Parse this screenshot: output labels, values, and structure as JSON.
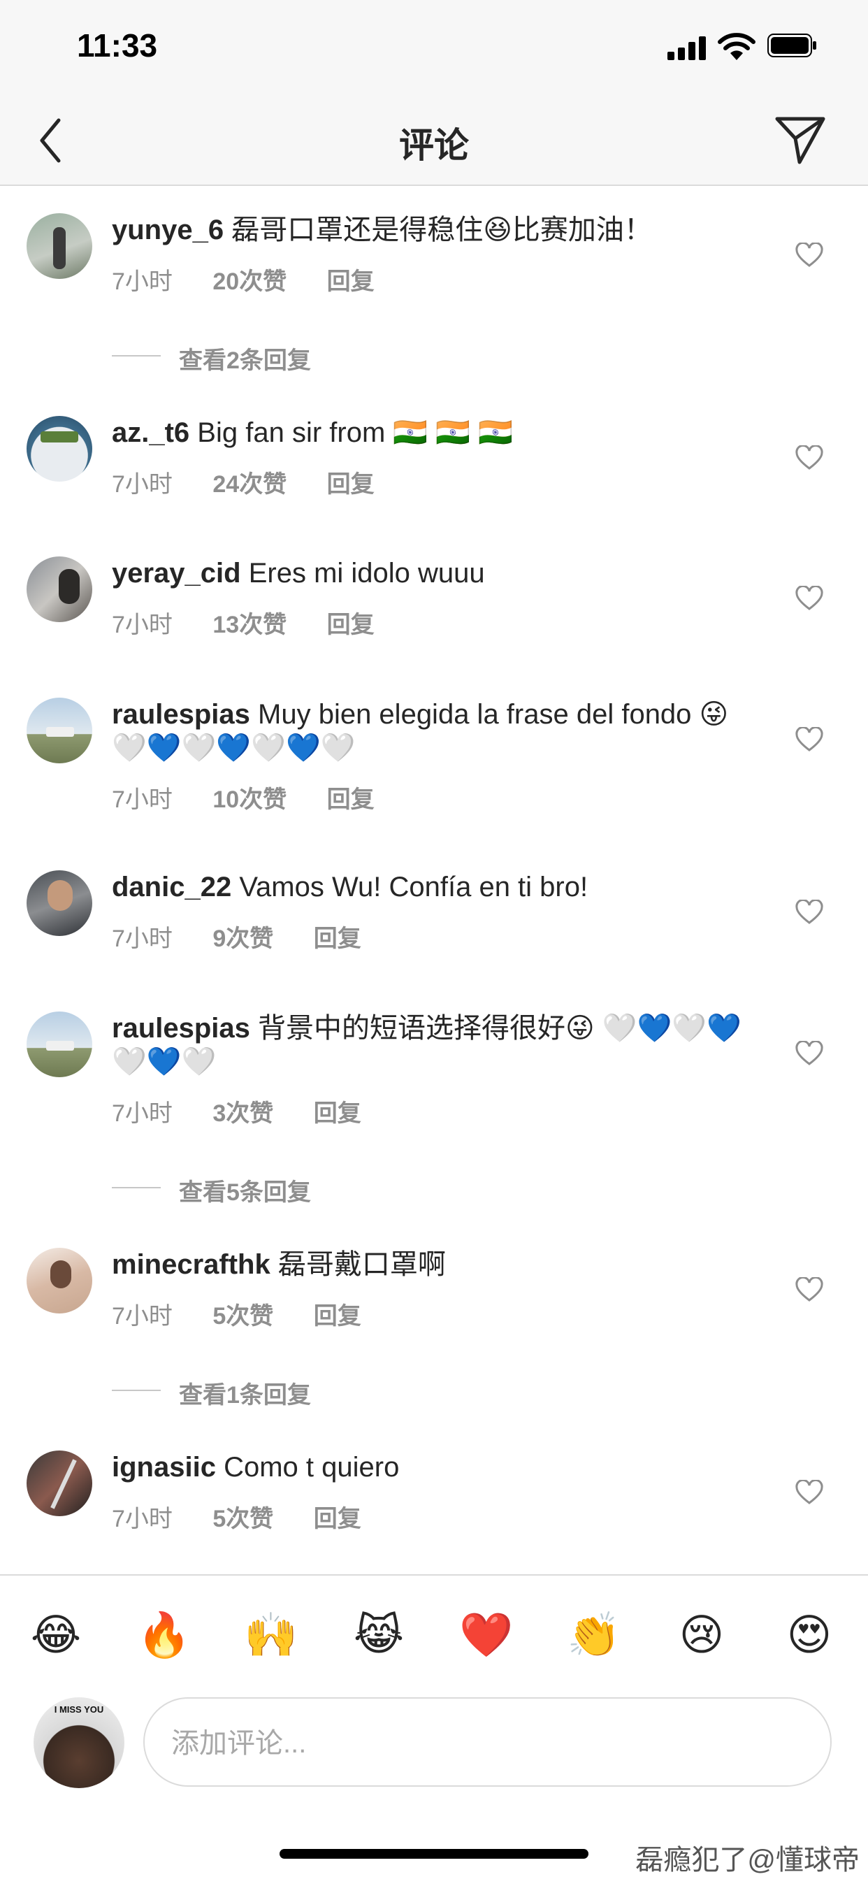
{
  "status": {
    "time": "11:33"
  },
  "nav": {
    "title": "评论"
  },
  "comments": [
    {
      "user": "yunye_6",
      "text": "磊哥口罩还是得稳住😆比赛加油！",
      "time": "7小时",
      "likes": "20次赞",
      "reply": "回复"
    },
    {
      "user": "az._t6",
      "text": "Big fan sir from 🇮🇳 🇮🇳 🇮🇳",
      "time": "7小时",
      "likes": "24次赞",
      "reply": "回复"
    },
    {
      "user": "yeray_cid",
      "text": "Eres mi idolo wuuu",
      "time": "7小时",
      "likes": "13次赞",
      "reply": "回复"
    },
    {
      "user": "raulespias",
      "text": "Muy bien elegida la frase del fondo 😜 🤍💙🤍💙🤍💙🤍",
      "time": "7小时",
      "likes": "10次赞",
      "reply": "回复"
    },
    {
      "user": "danic_22",
      "text": "Vamos Wu! Confía en ti bro!",
      "time": "7小时",
      "likes": "9次赞",
      "reply": "回复"
    },
    {
      "user": "raulespias",
      "text": "背景中的短语选择得很好😜 🤍💙🤍💙🤍💙🤍",
      "time": "7小时",
      "likes": "3次赞",
      "reply": "回复"
    },
    {
      "user": "minecrafthk",
      "text": "磊哥戴口罩啊",
      "time": "7小时",
      "likes": "5次赞",
      "reply": "回复"
    },
    {
      "user": "ignasiic",
      "text": "Como t quiero",
      "time": "7小时",
      "likes": "5次赞",
      "reply": "回复"
    }
  ],
  "view_replies": [
    "查看2条回复",
    "查看5条回复",
    "查看1条回复"
  ],
  "quick_emojis": [
    "😂",
    "🔥",
    "🙌",
    "😹",
    "❤️",
    "👏",
    "😢",
    "😍"
  ],
  "composer": {
    "placeholder": "添加评论...",
    "avatar_caption": "I MISS YOU"
  },
  "watermark": "磊瘾犯了@懂球帝",
  "colors": {
    "secondary_text": "#8e8e8e",
    "border": "#dbdbdb",
    "bar_bg": "#f7f7f7"
  }
}
